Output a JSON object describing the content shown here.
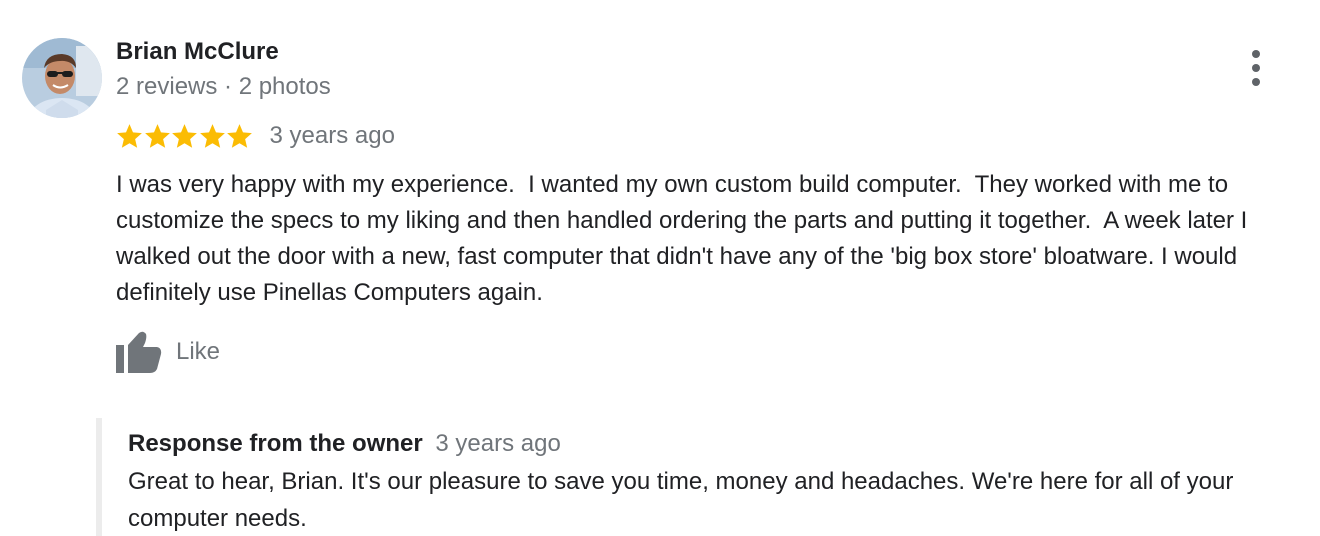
{
  "review": {
    "author": {
      "name": "Brian McClure",
      "meta": "2 reviews · 2 photos"
    },
    "rating": 5,
    "rating_max": 5,
    "star_color": "#fbbc04",
    "timestamp": "3 years ago",
    "text": "I was very happy with my experience.  I wanted my own custom build computer.  They worked with me to customize the specs to my liking and then handled ordering the parts and putting it together.  A week later I walked out the door with a new, fast computer that didn't have any of the 'big box store' bloatware. I would definitely use Pinellas Computers again.",
    "like_label": "Like",
    "like_icon": "thumbs-up-icon",
    "more_icon": "more-vert-icon"
  },
  "owner_response": {
    "title": "Response from the owner",
    "timestamp": "3 years ago",
    "text": "Great to hear, Brian. It's our pleasure to save you time, money and headaches. We're here for all of your computer needs."
  }
}
